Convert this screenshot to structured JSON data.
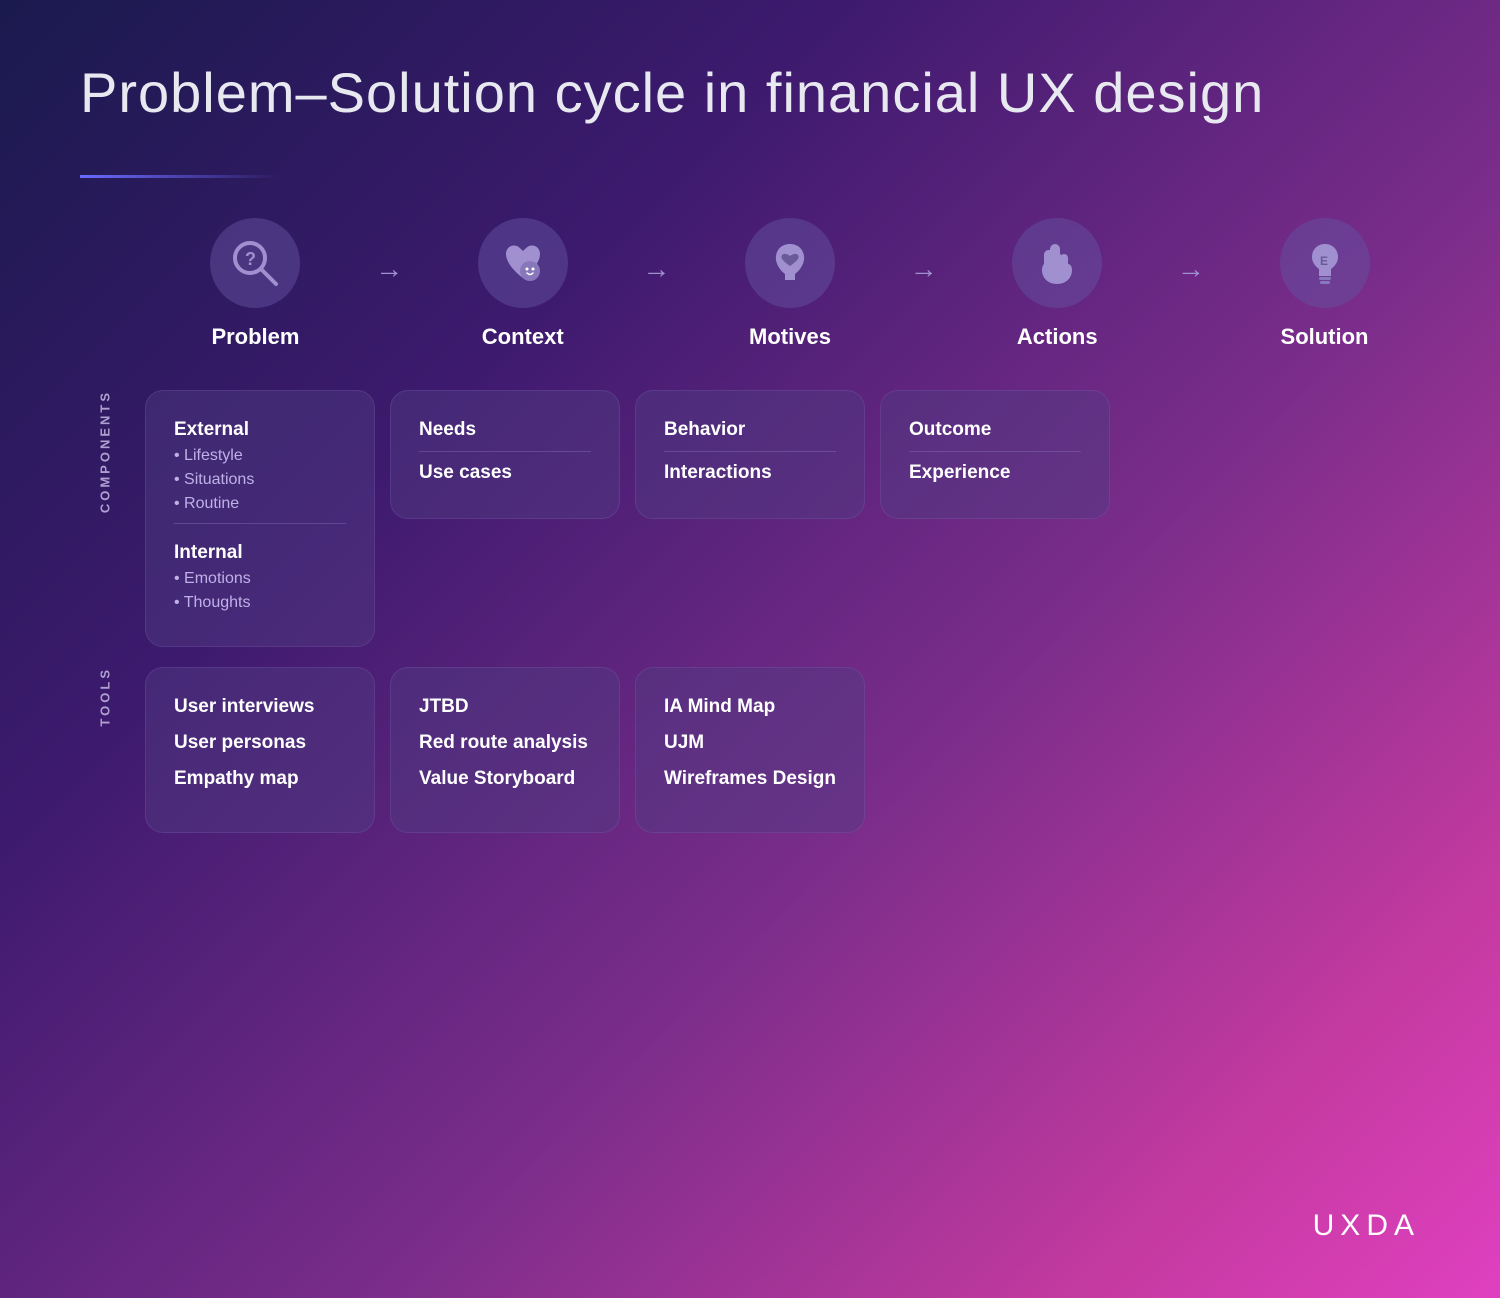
{
  "page": {
    "title": "Problem–Solution cycle in financial UX design"
  },
  "flow": {
    "items": [
      {
        "id": "problem",
        "label": "Problem"
      },
      {
        "id": "context",
        "label": "Context"
      },
      {
        "id": "motives",
        "label": "Motives"
      },
      {
        "id": "actions",
        "label": "Actions"
      },
      {
        "id": "solution",
        "label": "Solution"
      }
    ]
  },
  "rows": {
    "components_label": "COMPONENTS",
    "tools_label": "TOOLS"
  },
  "cards": {
    "context_components": {
      "external_title": "External",
      "external_items": [
        "• Lifestyle",
        "• Situations",
        "• Routine"
      ],
      "internal_title": "Internal",
      "internal_items": [
        "• Emotions",
        "• Thoughts"
      ]
    },
    "motives_components": {
      "needs_title": "Needs",
      "use_cases_title": "Use cases"
    },
    "actions_components": {
      "behavior_title": "Behavior",
      "interactions_title": "Interactions"
    },
    "solution_components": {
      "outcome_title": "Outcome",
      "experience_title": "Experience"
    },
    "context_tools": {
      "items": [
        "User interviews",
        "User personas",
        "Empathy map"
      ]
    },
    "motives_tools": {
      "items": [
        "JTBD",
        "Red route analysis",
        "Value Storyboard"
      ]
    },
    "actions_tools": {
      "items": [
        "IA Mind Map",
        "UJM",
        "Wireframes Design"
      ]
    }
  },
  "logo": "UXDA"
}
